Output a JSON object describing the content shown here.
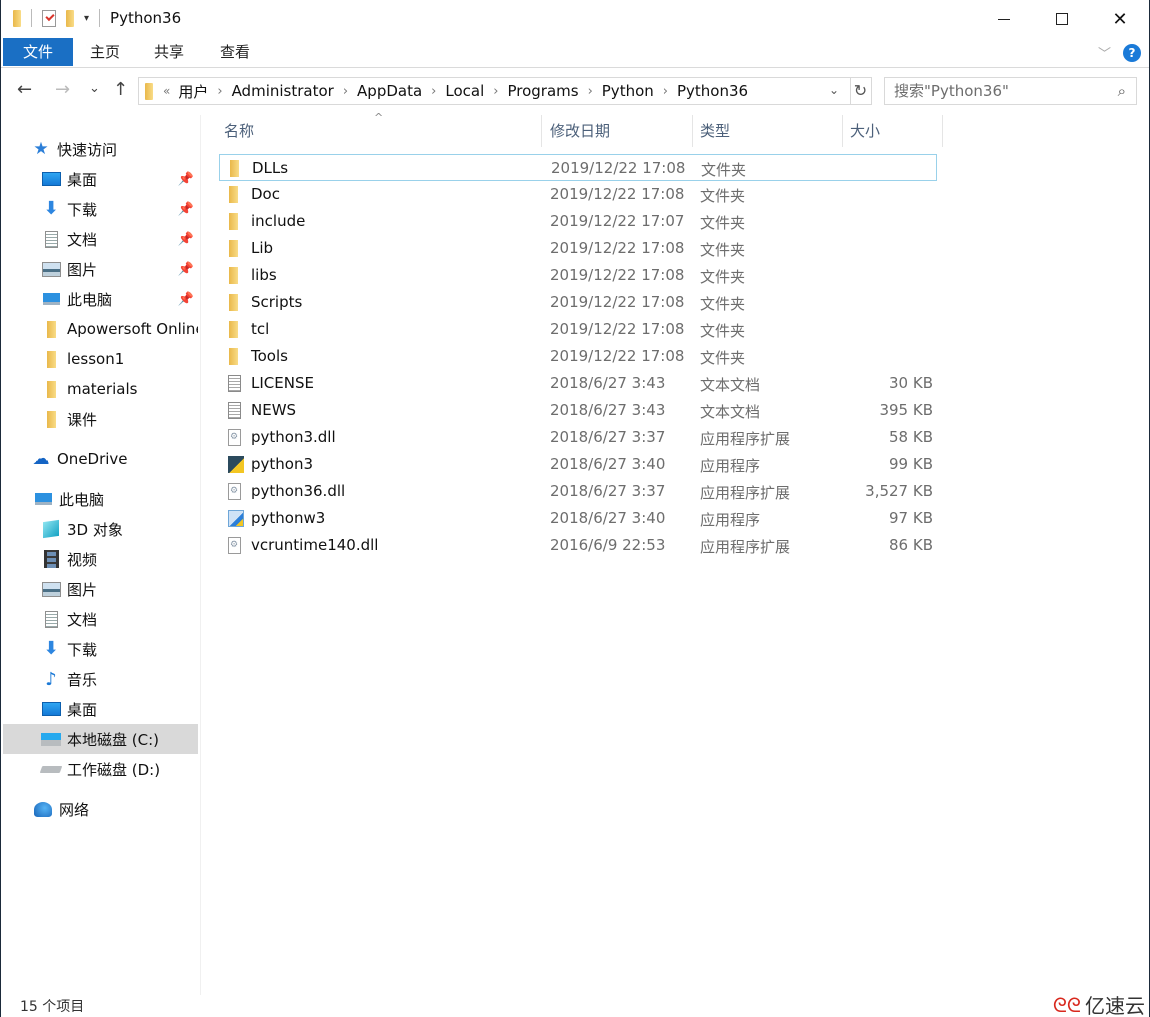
{
  "window": {
    "title": "Python36",
    "controls": {
      "minimize": "minimize",
      "maximize": "maximize",
      "close": "✕"
    }
  },
  "ribbon": {
    "tabs": [
      "文件",
      "主页",
      "共享",
      "查看"
    ],
    "active_tab": "文件",
    "accent": "#1a6fc4",
    "help_label": "?"
  },
  "nav": {
    "back": "←",
    "forward": "→",
    "recent": "⌄",
    "up": "↑",
    "overflow": "«",
    "breadcrumb": [
      "用户",
      "Administrator",
      "AppData",
      "Local",
      "Programs",
      "Python",
      "Python36"
    ],
    "crumb_sep": "›",
    "search_placeholder": "搜索\"Python36\""
  },
  "sidebar": {
    "quick_access": {
      "label": "快速访问",
      "items": [
        {
          "label": "桌面",
          "icon": "desktop-icon",
          "pinned": true
        },
        {
          "label": "下载",
          "icon": "download-icon",
          "pinned": true
        },
        {
          "label": "文档",
          "icon": "document-icon",
          "pinned": true
        },
        {
          "label": "图片",
          "icon": "pictures-icon",
          "pinned": true
        },
        {
          "label": "此电脑",
          "icon": "computer-icon",
          "pinned": true
        },
        {
          "label": "Apowersoft Online",
          "icon": "folder-icon",
          "pinned": false
        },
        {
          "label": "lesson1",
          "icon": "folder-icon",
          "pinned": false
        },
        {
          "label": "materials",
          "icon": "folder-icon",
          "pinned": false
        },
        {
          "label": "课件",
          "icon": "folder-icon",
          "pinned": false
        }
      ]
    },
    "onedrive": {
      "label": "OneDrive"
    },
    "this_pc": {
      "label": "此电脑",
      "items": [
        {
          "label": "3D 对象",
          "icon": "3d-objects-icon"
        },
        {
          "label": "视频",
          "icon": "video-icon"
        },
        {
          "label": "图片",
          "icon": "pictures-icon"
        },
        {
          "label": "文档",
          "icon": "document-icon"
        },
        {
          "label": "下载",
          "icon": "download-icon"
        },
        {
          "label": "音乐",
          "icon": "music-icon"
        },
        {
          "label": "桌面",
          "icon": "desktop-icon"
        },
        {
          "label": "本地磁盘 (C:)",
          "icon": "drive-c-icon",
          "selected": true
        },
        {
          "label": "工作磁盘 (D:)",
          "icon": "drive-icon"
        }
      ]
    },
    "network": {
      "label": "网络"
    }
  },
  "filelist": {
    "columns": {
      "name": "名称",
      "date": "修改日期",
      "type": "类型",
      "size": "大小"
    },
    "sort_indicator": "^",
    "rows": [
      {
        "name": "DLLs",
        "date": "2019/12/22 17:08",
        "type": "文件夹",
        "size": "",
        "kind": "folder",
        "selected": true
      },
      {
        "name": "Doc",
        "date": "2019/12/22 17:08",
        "type": "文件夹",
        "size": "",
        "kind": "folder"
      },
      {
        "name": "include",
        "date": "2019/12/22 17:07",
        "type": "文件夹",
        "size": "",
        "kind": "folder"
      },
      {
        "name": "Lib",
        "date": "2019/12/22 17:08",
        "type": "文件夹",
        "size": "",
        "kind": "folder"
      },
      {
        "name": "libs",
        "date": "2019/12/22 17:08",
        "type": "文件夹",
        "size": "",
        "kind": "folder"
      },
      {
        "name": "Scripts",
        "date": "2019/12/22 17:08",
        "type": "文件夹",
        "size": "",
        "kind": "folder"
      },
      {
        "name": "tcl",
        "date": "2019/12/22 17:08",
        "type": "文件夹",
        "size": "",
        "kind": "folder"
      },
      {
        "name": "Tools",
        "date": "2019/12/22 17:08",
        "type": "文件夹",
        "size": "",
        "kind": "folder"
      },
      {
        "name": "LICENSE",
        "date": "2018/6/27 3:43",
        "type": "文本文档",
        "size": "30 KB",
        "kind": "text"
      },
      {
        "name": "NEWS",
        "date": "2018/6/27 3:43",
        "type": "文本文档",
        "size": "395 KB",
        "kind": "text"
      },
      {
        "name": "python3.dll",
        "date": "2018/6/27 3:37",
        "type": "应用程序扩展",
        "size": "58 KB",
        "kind": "dll"
      },
      {
        "name": "python3",
        "date": "2018/6/27 3:40",
        "type": "应用程序",
        "size": "99 KB",
        "kind": "exe"
      },
      {
        "name": "python36.dll",
        "date": "2018/6/27 3:37",
        "type": "应用程序扩展",
        "size": "3,527 KB",
        "kind": "dll"
      },
      {
        "name": "pythonw3",
        "date": "2018/6/27 3:40",
        "type": "应用程序",
        "size": "97 KB",
        "kind": "exew"
      },
      {
        "name": "vcruntime140.dll",
        "date": "2016/6/9 22:53",
        "type": "应用程序扩展",
        "size": "86 KB",
        "kind": "dll"
      }
    ]
  },
  "status": {
    "item_count": "15 个项目"
  },
  "watermark": {
    "text": "亿速云",
    "logo": "ᘓ"
  }
}
